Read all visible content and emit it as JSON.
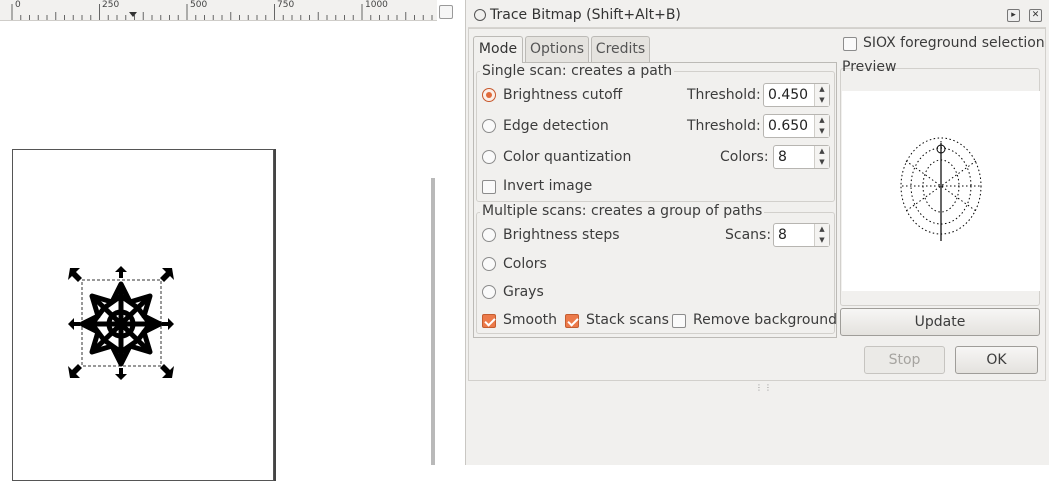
{
  "ruler": {
    "labels": [
      "0",
      "250",
      "500",
      "750",
      "1000"
    ]
  },
  "dialog": {
    "title": "Trace Bitmap (Shift+Alt+B)",
    "tabs": [
      "Mode",
      "Options",
      "Credits"
    ],
    "active_tab": "Mode",
    "single_scan": {
      "title": "Single scan: creates a path",
      "rows": [
        {
          "label": "Brightness cutoff",
          "checked": true,
          "field_label": "Threshold:",
          "value": "0.450"
        },
        {
          "label": "Edge detection",
          "checked": false,
          "field_label": "Threshold:",
          "value": "0.650"
        },
        {
          "label": "Color quantization",
          "checked": false,
          "field_label": "Colors:",
          "value": "8"
        }
      ],
      "invert_label": "Invert image",
      "invert_checked": false
    },
    "multiple_scans": {
      "title": "Multiple scans: creates a group of paths",
      "rows": [
        {
          "label": "Brightness steps",
          "checked": false,
          "field_label": "Scans:",
          "value": "8"
        },
        {
          "label": "Colors",
          "checked": false
        },
        {
          "label": "Grays",
          "checked": false
        }
      ],
      "smooth_label": "Smooth",
      "smooth_checked": true,
      "stack_label": "Stack scans",
      "stack_checked": true,
      "remove_bg_label": "Remove background",
      "remove_bg_checked": false
    },
    "siox_label": "SIOX foreground selection",
    "siox_checked": false,
    "preview_label": "Preview",
    "update_button": "Update",
    "stop_button": "Stop",
    "ok_button": "OK"
  },
  "colors": {
    "accent": "#ec7a4a",
    "dialog_bg": "#f1f0ee",
    "border": "#bcbab6"
  }
}
